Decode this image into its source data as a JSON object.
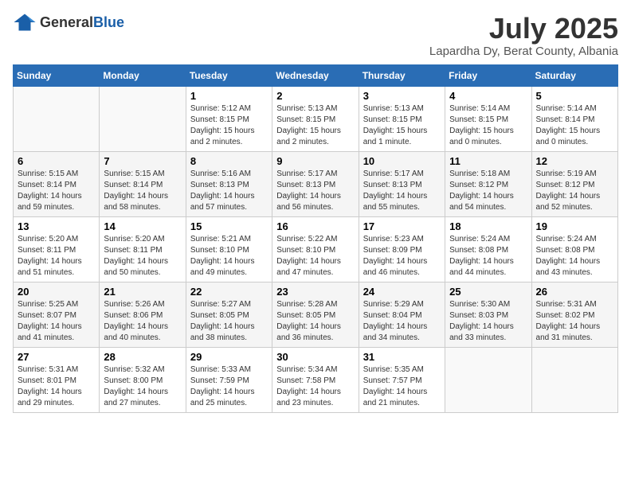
{
  "header": {
    "logo_general": "General",
    "logo_blue": "Blue",
    "month": "July 2025",
    "location": "Lapardha Dy, Berat County, Albania"
  },
  "days_of_week": [
    "Sunday",
    "Monday",
    "Tuesday",
    "Wednesday",
    "Thursday",
    "Friday",
    "Saturday"
  ],
  "weeks": [
    [
      {
        "day": "",
        "info": ""
      },
      {
        "day": "",
        "info": ""
      },
      {
        "day": "1",
        "info": "Sunrise: 5:12 AM\nSunset: 8:15 PM\nDaylight: 15 hours and 2 minutes."
      },
      {
        "day": "2",
        "info": "Sunrise: 5:13 AM\nSunset: 8:15 PM\nDaylight: 15 hours and 2 minutes."
      },
      {
        "day": "3",
        "info": "Sunrise: 5:13 AM\nSunset: 8:15 PM\nDaylight: 15 hours and 1 minute."
      },
      {
        "day": "4",
        "info": "Sunrise: 5:14 AM\nSunset: 8:15 PM\nDaylight: 15 hours and 0 minutes."
      },
      {
        "day": "5",
        "info": "Sunrise: 5:14 AM\nSunset: 8:14 PM\nDaylight: 15 hours and 0 minutes."
      }
    ],
    [
      {
        "day": "6",
        "info": "Sunrise: 5:15 AM\nSunset: 8:14 PM\nDaylight: 14 hours and 59 minutes."
      },
      {
        "day": "7",
        "info": "Sunrise: 5:15 AM\nSunset: 8:14 PM\nDaylight: 14 hours and 58 minutes."
      },
      {
        "day": "8",
        "info": "Sunrise: 5:16 AM\nSunset: 8:13 PM\nDaylight: 14 hours and 57 minutes."
      },
      {
        "day": "9",
        "info": "Sunrise: 5:17 AM\nSunset: 8:13 PM\nDaylight: 14 hours and 56 minutes."
      },
      {
        "day": "10",
        "info": "Sunrise: 5:17 AM\nSunset: 8:13 PM\nDaylight: 14 hours and 55 minutes."
      },
      {
        "day": "11",
        "info": "Sunrise: 5:18 AM\nSunset: 8:12 PM\nDaylight: 14 hours and 54 minutes."
      },
      {
        "day": "12",
        "info": "Sunrise: 5:19 AM\nSunset: 8:12 PM\nDaylight: 14 hours and 52 minutes."
      }
    ],
    [
      {
        "day": "13",
        "info": "Sunrise: 5:20 AM\nSunset: 8:11 PM\nDaylight: 14 hours and 51 minutes."
      },
      {
        "day": "14",
        "info": "Sunrise: 5:20 AM\nSunset: 8:11 PM\nDaylight: 14 hours and 50 minutes."
      },
      {
        "day": "15",
        "info": "Sunrise: 5:21 AM\nSunset: 8:10 PM\nDaylight: 14 hours and 49 minutes."
      },
      {
        "day": "16",
        "info": "Sunrise: 5:22 AM\nSunset: 8:10 PM\nDaylight: 14 hours and 47 minutes."
      },
      {
        "day": "17",
        "info": "Sunrise: 5:23 AM\nSunset: 8:09 PM\nDaylight: 14 hours and 46 minutes."
      },
      {
        "day": "18",
        "info": "Sunrise: 5:24 AM\nSunset: 8:08 PM\nDaylight: 14 hours and 44 minutes."
      },
      {
        "day": "19",
        "info": "Sunrise: 5:24 AM\nSunset: 8:08 PM\nDaylight: 14 hours and 43 minutes."
      }
    ],
    [
      {
        "day": "20",
        "info": "Sunrise: 5:25 AM\nSunset: 8:07 PM\nDaylight: 14 hours and 41 minutes."
      },
      {
        "day": "21",
        "info": "Sunrise: 5:26 AM\nSunset: 8:06 PM\nDaylight: 14 hours and 40 minutes."
      },
      {
        "day": "22",
        "info": "Sunrise: 5:27 AM\nSunset: 8:05 PM\nDaylight: 14 hours and 38 minutes."
      },
      {
        "day": "23",
        "info": "Sunrise: 5:28 AM\nSunset: 8:05 PM\nDaylight: 14 hours and 36 minutes."
      },
      {
        "day": "24",
        "info": "Sunrise: 5:29 AM\nSunset: 8:04 PM\nDaylight: 14 hours and 34 minutes."
      },
      {
        "day": "25",
        "info": "Sunrise: 5:30 AM\nSunset: 8:03 PM\nDaylight: 14 hours and 33 minutes."
      },
      {
        "day": "26",
        "info": "Sunrise: 5:31 AM\nSunset: 8:02 PM\nDaylight: 14 hours and 31 minutes."
      }
    ],
    [
      {
        "day": "27",
        "info": "Sunrise: 5:31 AM\nSunset: 8:01 PM\nDaylight: 14 hours and 29 minutes."
      },
      {
        "day": "28",
        "info": "Sunrise: 5:32 AM\nSunset: 8:00 PM\nDaylight: 14 hours and 27 minutes."
      },
      {
        "day": "29",
        "info": "Sunrise: 5:33 AM\nSunset: 7:59 PM\nDaylight: 14 hours and 25 minutes."
      },
      {
        "day": "30",
        "info": "Sunrise: 5:34 AM\nSunset: 7:58 PM\nDaylight: 14 hours and 23 minutes."
      },
      {
        "day": "31",
        "info": "Sunrise: 5:35 AM\nSunset: 7:57 PM\nDaylight: 14 hours and 21 minutes."
      },
      {
        "day": "",
        "info": ""
      },
      {
        "day": "",
        "info": ""
      }
    ]
  ]
}
